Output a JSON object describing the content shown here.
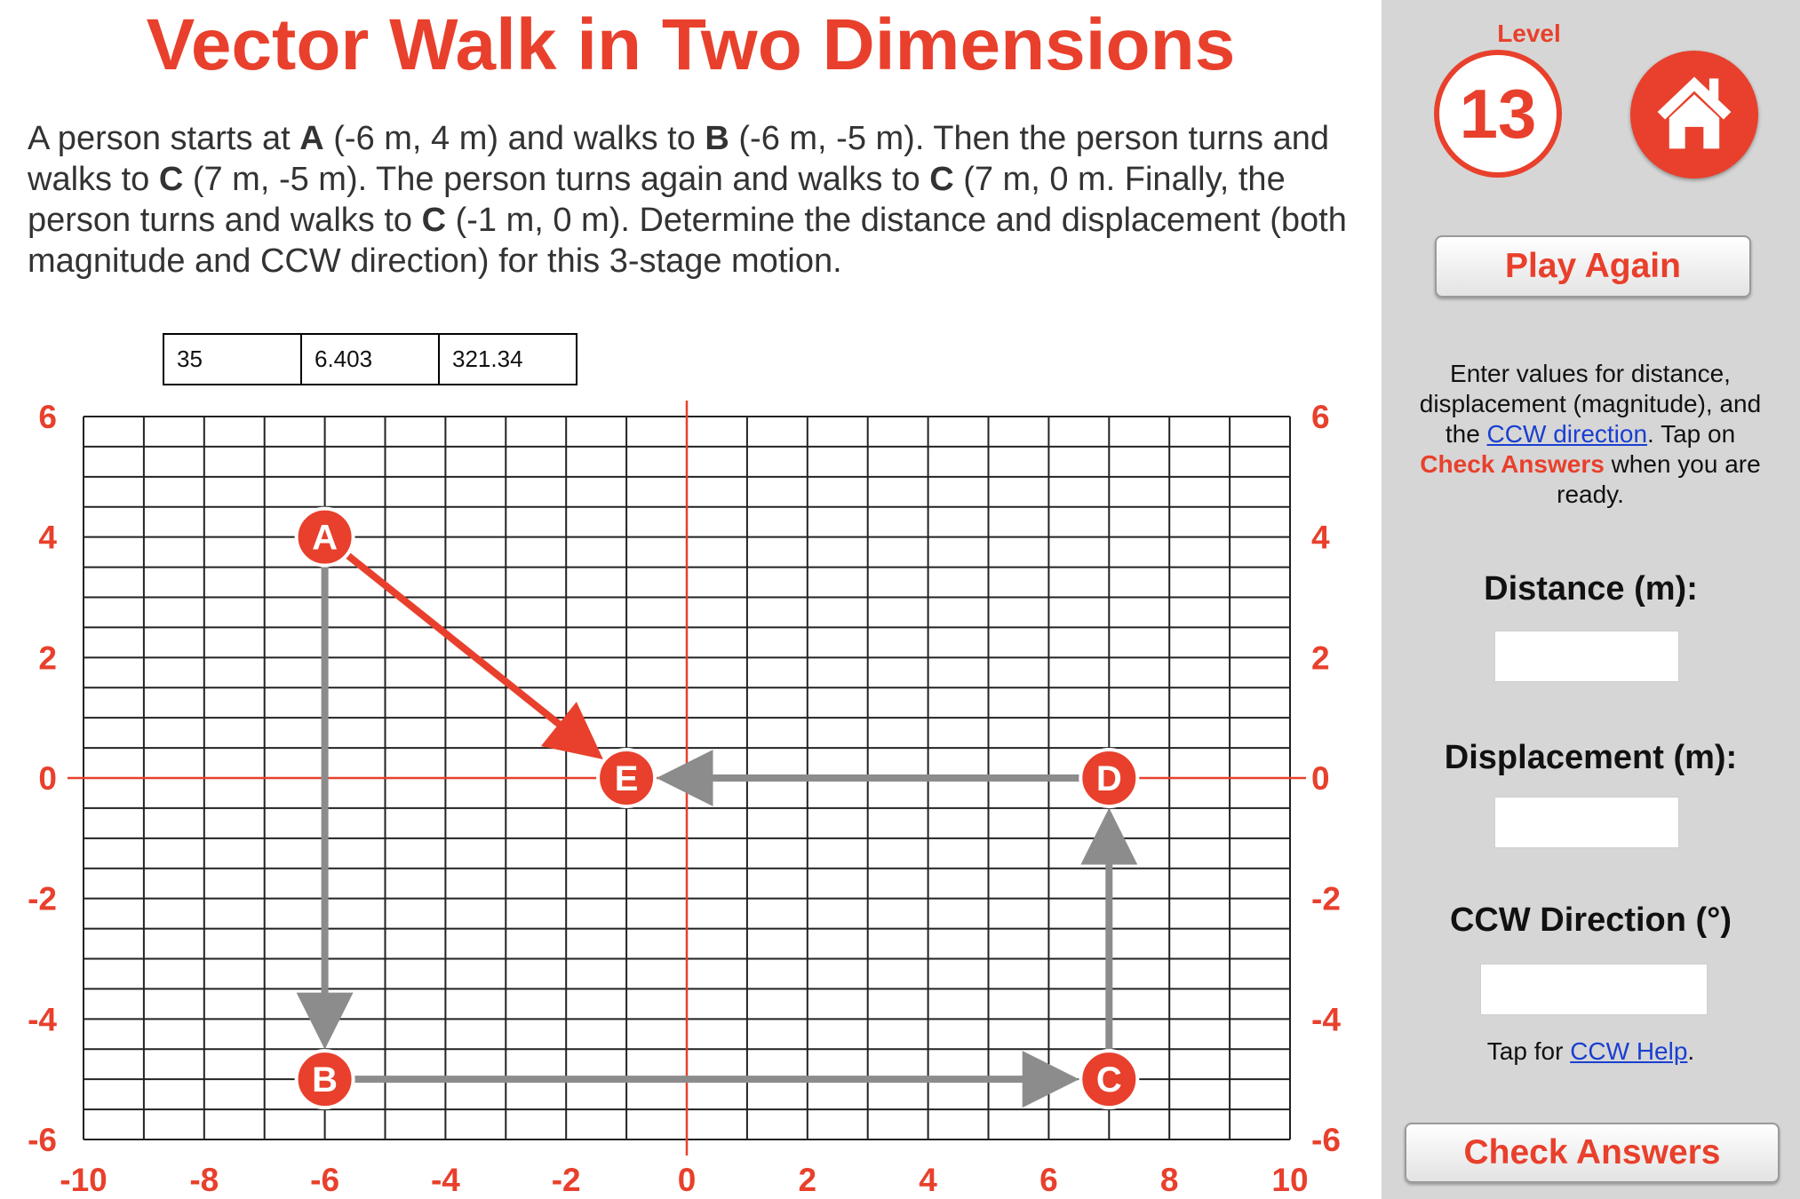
{
  "title": "Vector Walk in Two Dimensions",
  "problem": {
    "p1": "A person starts at ",
    "A_label": "A",
    "p2": " (-6 m, 4 m) and walks to ",
    "B_label": "B",
    "p3": " (-6 m, -5 m). Then the person turns and walks to ",
    "C1_label": "C",
    "p4": " (7 m, -5 m). The person turns again and walks to ",
    "C2_label": "C",
    "p5": " (7 m, 0 m. Finally, the person turns and walks to ",
    "C3_label": "C",
    "p6": " (-1 m, 0 m). Determine the distance and displacement (both magnitude and CCW direction) for this 3-stage motion."
  },
  "entered_values": [
    "35",
    "6.403",
    "321.34"
  ],
  "chart_data": {
    "type": "scatter",
    "xlim": [
      -10,
      10
    ],
    "ylim": [
      -6,
      6
    ],
    "grid": true,
    "x_tick_labels": [
      "-10",
      "-8",
      "-6",
      "-4",
      "-2",
      "0",
      "2",
      "4",
      "6",
      "8",
      "10"
    ],
    "y_tick_labels": [
      "-6",
      "-4",
      "-2",
      "0",
      "2",
      "4",
      "6"
    ],
    "points": [
      {
        "label": "A",
        "x": -6,
        "y": 4
      },
      {
        "label": "B",
        "x": -6,
        "y": -5
      },
      {
        "label": "C",
        "x": 7,
        "y": -5
      },
      {
        "label": "D",
        "x": 7,
        "y": 0
      },
      {
        "label": "E",
        "x": -1,
        "y": 0
      }
    ],
    "path_vectors": [
      {
        "from": "A",
        "to": "B"
      },
      {
        "from": "B",
        "to": "C"
      },
      {
        "from": "C",
        "to": "D"
      },
      {
        "from": "D",
        "to": "E"
      }
    ],
    "displacement_vector": {
      "from": "A",
      "to": "E"
    }
  },
  "colors": {
    "accent": "#e8402c",
    "path": "#8c8c8c",
    "grid": "#222222",
    "sidebar_bg": "#d6d6d6",
    "link": "#1a3fd0"
  },
  "sidebar": {
    "level_label": "Level",
    "level_number": "13",
    "home_icon": "home-icon",
    "play_again": "Play Again",
    "instructions": {
      "t1": "Enter values for distance, displacement (magnitude), and the ",
      "link": "CCW direction",
      "t2": ". Tap on ",
      "hl": "Check Answers",
      "t3": " when you are ready."
    },
    "distance_label": "Distance (m):",
    "distance_value": "",
    "displacement_label": "Displacement (m):",
    "displacement_value": "",
    "direction_label": "CCW Direction (°)",
    "direction_value": "",
    "help_prefix": "Tap for ",
    "help_link": "CCW Help",
    "help_suffix": ".",
    "check_answers": "Check Answers"
  }
}
